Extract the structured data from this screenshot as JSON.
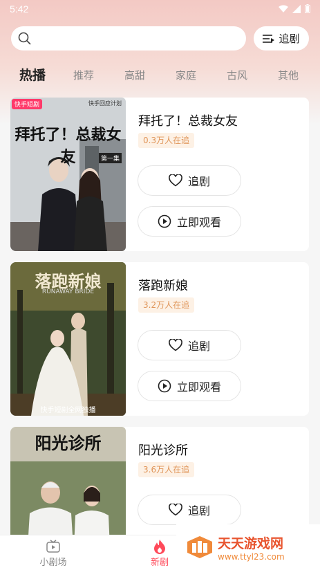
{
  "status": {
    "time": "5:42"
  },
  "header": {
    "search_placeholder": "",
    "follow_label": "追剧"
  },
  "tabs": [
    "热播",
    "推荐",
    "高甜",
    "家庭",
    "古风",
    "其他"
  ],
  "dramas": [
    {
      "title": "拜托了！总裁女友",
      "viewers": "0.3万人在追",
      "follow_label": "追剧",
      "watch_label": "立即观看",
      "poster_title": "拜托了！总裁女友",
      "poster_badge": "快手短剧",
      "poster_note": "快手回应计划",
      "poster_ep": "第一集"
    },
    {
      "title": "落跑新娘",
      "viewers": "3.2万人在追",
      "follow_label": "追剧",
      "watch_label": "立即观看",
      "poster_title": "落跑新娘",
      "poster_sub": "RUNAWAY BRIDE",
      "poster_bottom": "快手短剧全网独播"
    },
    {
      "title": "阳光诊所",
      "viewers": "3.6万人在追",
      "follow_label": "追剧",
      "poster_title": "阳光诊所"
    }
  ],
  "bottom_nav": [
    {
      "label": "小剧场",
      "icon": "tv-icon"
    },
    {
      "label": "新剧",
      "icon": "flame-icon"
    }
  ],
  "watermark": {
    "name": "天天游戏网",
    "url": "www.ttyl23.com"
  },
  "colors": {
    "accent": "#ff4a5a",
    "viewers_text": "#e0965a",
    "header_bg": "#f3c9c4"
  }
}
